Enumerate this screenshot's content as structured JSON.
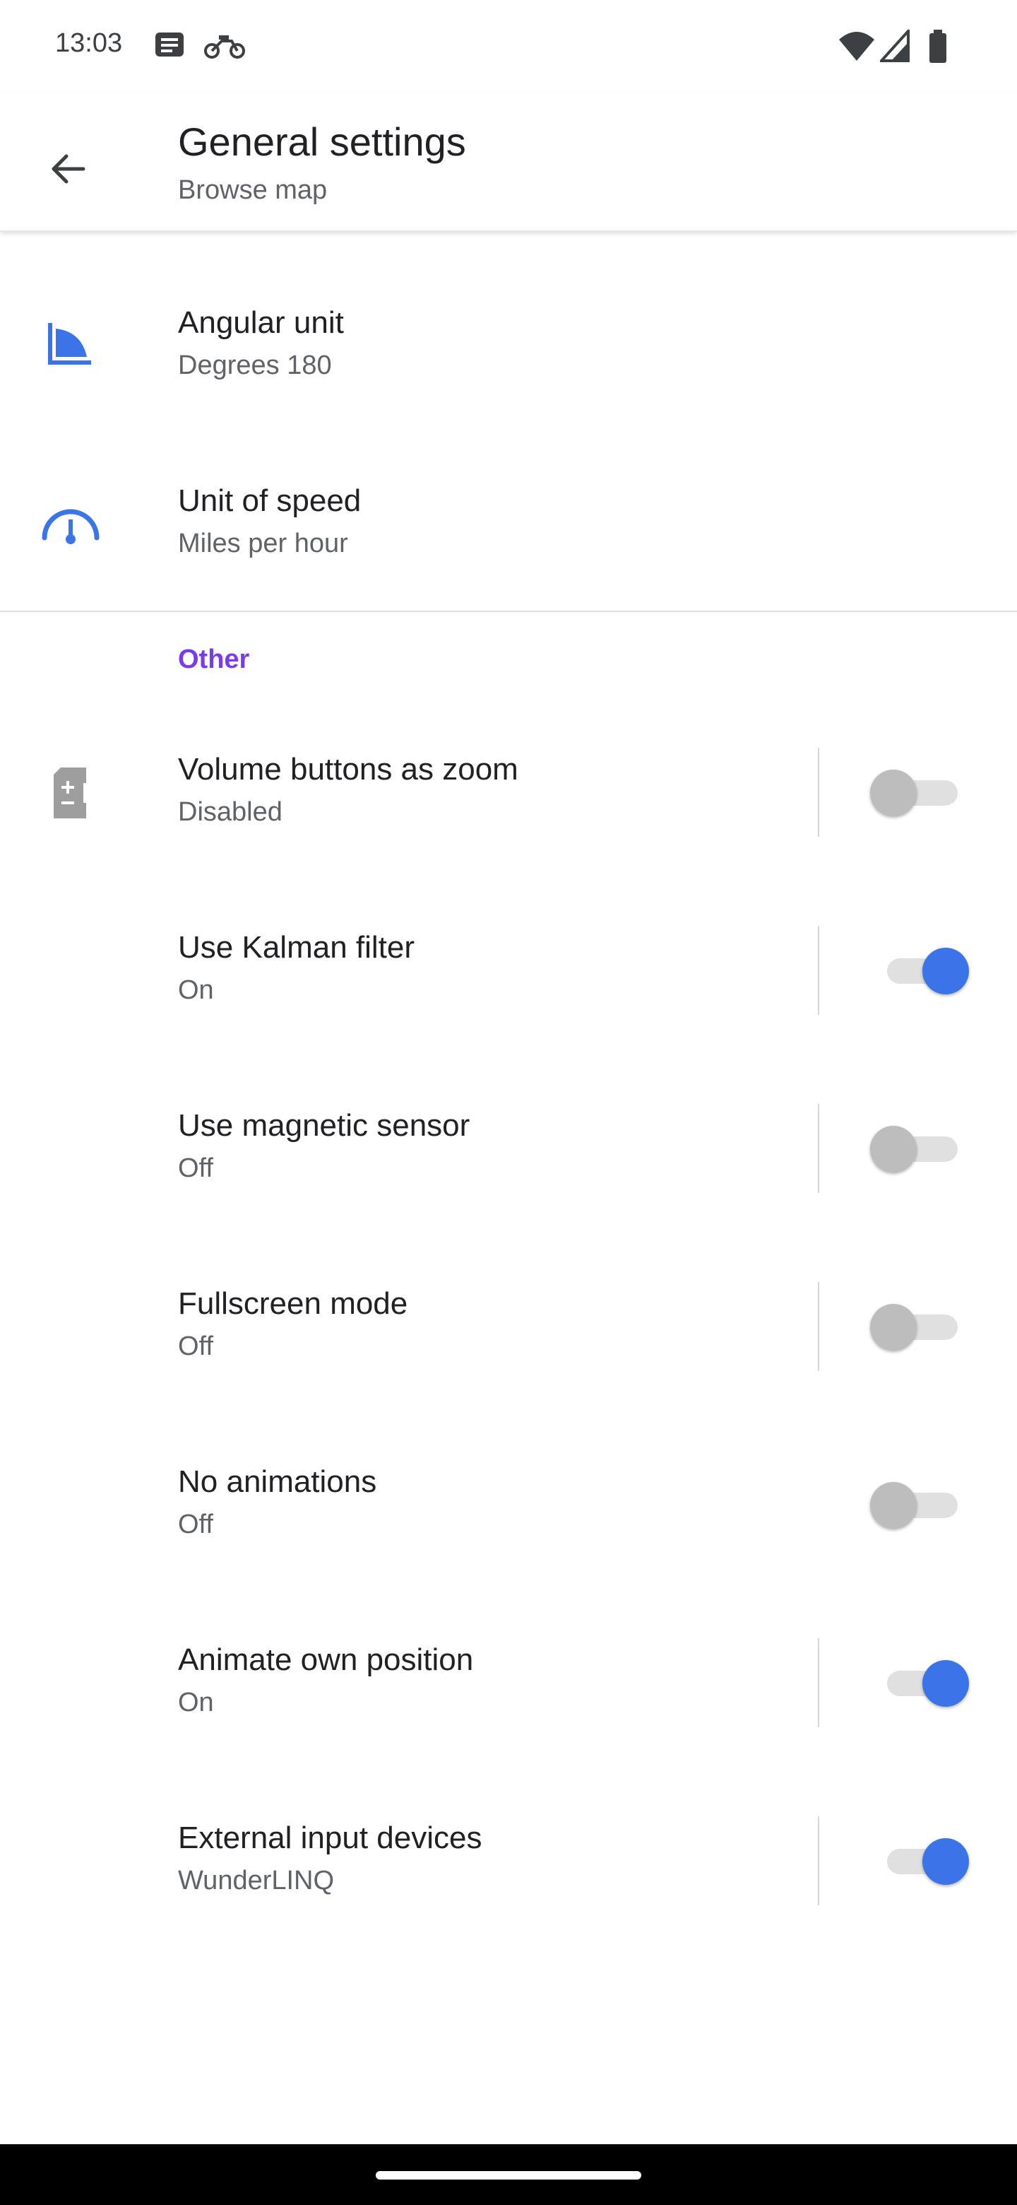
{
  "status_bar": {
    "time": "13:03",
    "icons": [
      "message-icon",
      "motorbike-icon",
      "wifi-icon",
      "signal-icon",
      "battery-icon"
    ]
  },
  "app_bar": {
    "title": "General settings",
    "subtitle": "Browse map",
    "back_icon": "arrow-left-icon"
  },
  "settings": [
    {
      "title": "Angular unit",
      "subtitle": "Degrees 180",
      "icon": "angle-icon"
    },
    {
      "title": "Unit of speed",
      "subtitle": "Miles per hour",
      "icon": "speedometer-icon"
    }
  ],
  "section": {
    "label": "Other"
  },
  "other": [
    {
      "title": "Volume buttons as zoom",
      "subtitle": "Disabled",
      "icon": "volume-zoom-icon",
      "toggle": false
    },
    {
      "title": "Use Kalman filter",
      "subtitle": "On",
      "toggle": true
    },
    {
      "title": "Use magnetic sensor",
      "subtitle": "Off",
      "toggle": false
    },
    {
      "title": "Fullscreen mode",
      "subtitle": "Off",
      "toggle": false
    },
    {
      "title": "No animations",
      "subtitle": "Off",
      "toggle": false
    },
    {
      "title": "Animate own position",
      "subtitle": "On",
      "toggle": true
    },
    {
      "title": "External input devices",
      "subtitle": "WunderLINQ",
      "toggle": true
    }
  ],
  "colors": {
    "accent": "#3b73e8",
    "section_label": "#7c3aed",
    "icon_blue": "#3b73e8",
    "switch_off_thumb": "#bdbdbd"
  }
}
